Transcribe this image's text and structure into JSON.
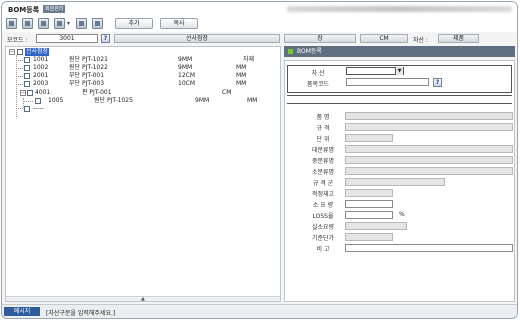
{
  "window": {
    "title": "BOM등록",
    "title_tag": "회원관리"
  },
  "toolbar": {
    "add_label": "추가",
    "copy_label": "복사"
  },
  "code_row": {
    "label": "모코드 :",
    "value": "3001",
    "name_bar": "선사점장",
    "unit_bar": "장",
    "cm_bar": "CM",
    "asset_label": "자산 :",
    "asset_value": "제품"
  },
  "tree": {
    "root_label": "선사점장",
    "rows": [
      {
        "code": "1001",
        "spec": "원단 PJT-1021",
        "size": "9MM",
        "unit": "자재"
      },
      {
        "code": "1002",
        "spec": "원단 PJT-1022",
        "size": "9MM",
        "unit": "MM"
      },
      {
        "code": "2001",
        "spec": "부단 PJT-001",
        "size": "12CM",
        "unit": "MM"
      },
      {
        "code": "2003",
        "spec": "부단 PJT-003",
        "size": "10CM",
        "unit": "MM"
      },
      {
        "code": "4001",
        "spec": "판 PJT-001",
        "size": "",
        "unit": "CM"
      },
      {
        "code": "1005",
        "spec": "원단 PJT-1025",
        "size": "9MM",
        "unit": "MM"
      },
      {
        "code": "-----",
        "spec": "",
        "size": "",
        "unit": ""
      }
    ]
  },
  "right_panel": {
    "header": "BOM등록",
    "asset_label": "자 산",
    "item_code_label": "품목코드",
    "fields": [
      {
        "label": "품 명"
      },
      {
        "label": "규 격"
      },
      {
        "label": "단 위"
      },
      {
        "label": "대분류명"
      },
      {
        "label": "중분류명"
      },
      {
        "label": "소분류명"
      },
      {
        "label": "규 격 군"
      },
      {
        "label": "적정재고"
      },
      {
        "label": "소 요 량"
      },
      {
        "label": "LOSS율"
      },
      {
        "label": "실소요량"
      },
      {
        "label": "기준단가"
      },
      {
        "label": "비 고"
      }
    ],
    "loss_unit": "%"
  },
  "status": {
    "tag": "메시지",
    "message": "[자산구분을 입력해주세요.]"
  }
}
